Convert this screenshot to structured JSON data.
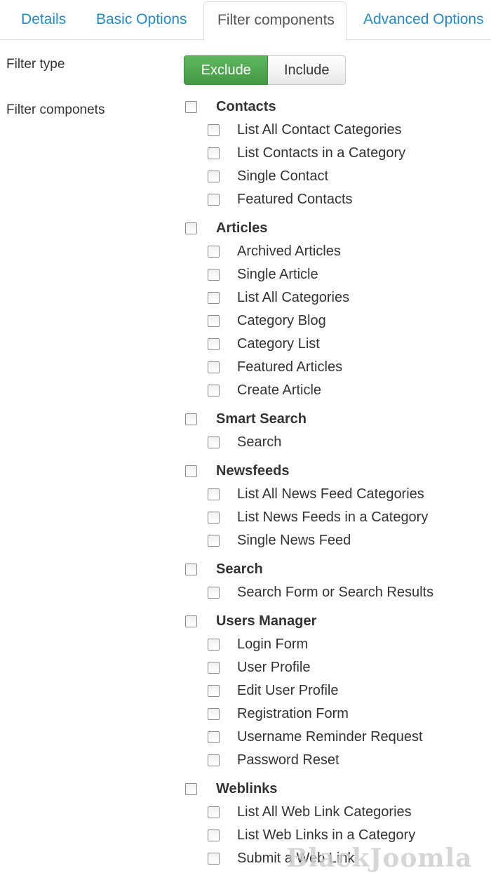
{
  "tabs": [
    {
      "label": "Details"
    },
    {
      "label": "Basic Options"
    },
    {
      "label": "Filter components",
      "active": true
    },
    {
      "label": "Advanced Options"
    }
  ],
  "filter_type": {
    "label": "Filter type",
    "options": [
      {
        "label": "Exclude",
        "selected": true
      },
      {
        "label": "Include",
        "selected": false
      }
    ]
  },
  "filter_components": {
    "label": "Filter componets",
    "groups": [
      {
        "label": "Contacts",
        "checked": false,
        "items": [
          {
            "label": "List All Contact Categories",
            "checked": false
          },
          {
            "label": "List Contacts in a Category",
            "checked": false
          },
          {
            "label": "Single Contact",
            "checked": false
          },
          {
            "label": "Featured Contacts",
            "checked": false
          }
        ]
      },
      {
        "label": "Articles",
        "checked": false,
        "items": [
          {
            "label": "Archived Articles",
            "checked": false
          },
          {
            "label": "Single Article",
            "checked": false
          },
          {
            "label": "List All Categories",
            "checked": false
          },
          {
            "label": "Category Blog",
            "checked": false
          },
          {
            "label": "Category List",
            "checked": false
          },
          {
            "label": "Featured Articles",
            "checked": false
          },
          {
            "label": "Create Article",
            "checked": false
          }
        ]
      },
      {
        "label": "Smart Search",
        "checked": false,
        "items": [
          {
            "label": "Search",
            "checked": false
          }
        ]
      },
      {
        "label": "Newsfeeds",
        "checked": false,
        "items": [
          {
            "label": "List All News Feed Categories",
            "checked": false
          },
          {
            "label": "List News Feeds in a Category",
            "checked": false
          },
          {
            "label": "Single News Feed",
            "checked": false
          }
        ]
      },
      {
        "label": "Search",
        "checked": false,
        "items": [
          {
            "label": "Search Form or Search Results",
            "checked": false
          }
        ]
      },
      {
        "label": "Users Manager",
        "checked": false,
        "items": [
          {
            "label": "Login Form",
            "checked": false
          },
          {
            "label": "User Profile",
            "checked": false
          },
          {
            "label": "Edit User Profile",
            "checked": false
          },
          {
            "label": "Registration Form",
            "checked": false
          },
          {
            "label": "Username Reminder Request",
            "checked": false
          },
          {
            "label": "Password Reset",
            "checked": false
          }
        ]
      },
      {
        "label": "Weblinks",
        "checked": false,
        "items": [
          {
            "label": "List All Web Link Categories",
            "checked": false
          },
          {
            "label": "List Web Links in a Category",
            "checked": false
          },
          {
            "label": "Submit a Web Link",
            "checked": false
          }
        ]
      }
    ]
  },
  "watermark": {
    "text": "BlackJoomla"
  },
  "colors": {
    "accent_link": "#1f8bc7",
    "exclude_active": "#51a351"
  }
}
